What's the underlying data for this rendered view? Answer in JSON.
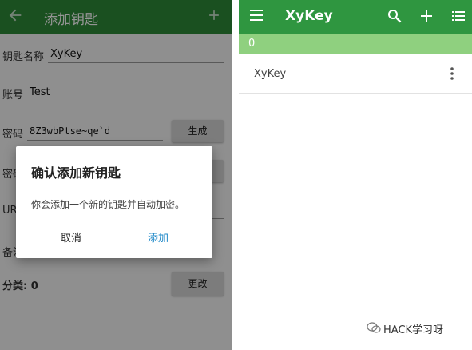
{
  "left": {
    "appbar": {
      "title": "添加钥匙"
    },
    "form": {
      "key_name_label": "钥匙名称",
      "key_name_value": "XyKey",
      "account_label": "账号",
      "account_value": "Test",
      "password_label": "密码",
      "password_value": "8Z3wbPtse~qe`d",
      "generate_button": "生成",
      "partial_label_1": "密码",
      "partial_label_2": "UR",
      "partial_label_3": "备注",
      "category_label": "分类: 0",
      "change_button": "更改"
    },
    "dialog": {
      "title": "确认添加新钥匙",
      "message": "你会添加一个新的钥匙并自动加密。",
      "cancel": "取消",
      "confirm": "添加"
    }
  },
  "right": {
    "toolbar": {
      "title": "XyKey"
    },
    "count": "0",
    "keys": [
      {
        "name": "XyKey"
      }
    ]
  },
  "watermark": "HACK学习呀",
  "colors": {
    "appbar": "#2e8b38",
    "accent": "#2f9640",
    "count_bar": "#8fd07f",
    "dialog_button": "#1e88c8"
  }
}
